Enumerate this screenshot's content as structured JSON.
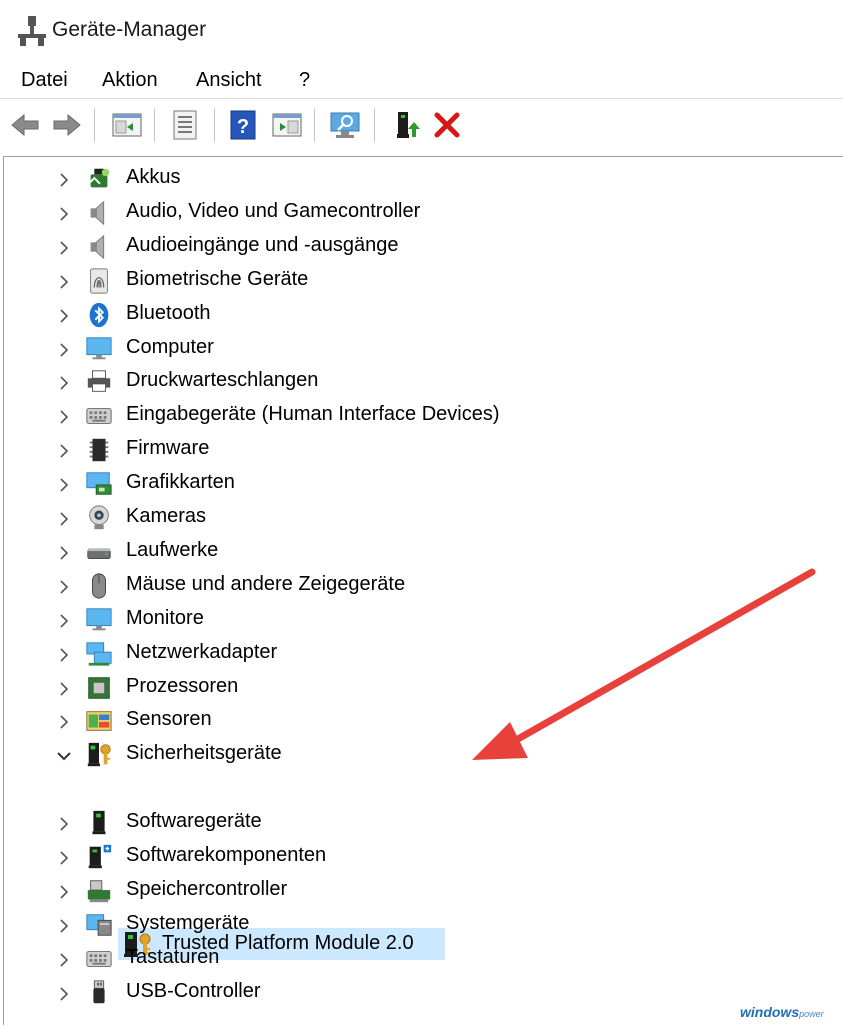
{
  "window": {
    "title": "Geräte-Manager"
  },
  "menu": [
    "Datei",
    "Aktion",
    "Ansicht",
    "?"
  ],
  "toolbar": {
    "buttons": [
      "back-icon",
      "forward-icon",
      "properties-pane-icon",
      "device-list-icon",
      "help-icon",
      "action-pane-icon",
      "scan-hardware-icon",
      "update-driver-icon",
      "uninstall-device-icon"
    ]
  },
  "tree": {
    "categories": [
      {
        "label": "Akkus",
        "icon": "battery-icon",
        "expanded": false
      },
      {
        "label": "Audio, Video und Gamecontroller",
        "icon": "speaker-icon",
        "expanded": false
      },
      {
        "label": "Audioeingänge und -ausgänge",
        "icon": "speaker-icon",
        "expanded": false
      },
      {
        "label": "Biometrische Geräte",
        "icon": "fingerprint-icon",
        "expanded": false
      },
      {
        "label": "Bluetooth",
        "icon": "bluetooth-icon",
        "expanded": false
      },
      {
        "label": "Computer",
        "icon": "monitor-icon",
        "expanded": false
      },
      {
        "label": "Druckwarteschlangen",
        "icon": "printer-icon",
        "expanded": false
      },
      {
        "label": "Eingabegeräte (Human Interface Devices)",
        "icon": "keyboard-icon",
        "expanded": false
      },
      {
        "label": "Firmware",
        "icon": "chip-icon",
        "expanded": false
      },
      {
        "label": "Grafikkarten",
        "icon": "display-adapter-icon",
        "expanded": false
      },
      {
        "label": "Kameras",
        "icon": "camera-icon",
        "expanded": false
      },
      {
        "label": "Laufwerke",
        "icon": "drive-icon",
        "expanded": false
      },
      {
        "label": "Mäuse und andere Zeigegeräte",
        "icon": "mouse-icon",
        "expanded": false
      },
      {
        "label": "Monitore",
        "icon": "monitor-icon",
        "expanded": false
      },
      {
        "label": "Netzwerkadapter",
        "icon": "network-icon",
        "expanded": false
      },
      {
        "label": "Prozessoren",
        "icon": "processor-icon",
        "expanded": false
      },
      {
        "label": "Sensoren",
        "icon": "sensor-icon",
        "expanded": false
      },
      {
        "label": "Sicherheitsgeräte",
        "icon": "security-key-icon",
        "expanded": true
      },
      {
        "label": "Softwaregeräte",
        "icon": "software-device-icon",
        "expanded": false
      },
      {
        "label": "Softwarekomponenten",
        "icon": "software-component-icon",
        "expanded": false
      },
      {
        "label": "Speichercontroller",
        "icon": "storage-controller-icon",
        "expanded": false
      },
      {
        "label": "Systemgeräte",
        "icon": "system-icon",
        "expanded": false
      },
      {
        "label": "Tastaturen",
        "icon": "keyboard-icon",
        "expanded": false
      },
      {
        "label": "USB-Controller",
        "icon": "usb-icon",
        "expanded": false
      }
    ],
    "selected_child": {
      "label": "Trusted Platform Module 2.0",
      "icon": "security-key-icon",
      "parent": "Sicherheitsgeräte"
    }
  },
  "annotation": {
    "type": "red-arrow",
    "points_to": "Trusted Platform Module 2.0"
  },
  "watermark": {
    "brand": "windows",
    "suffix": "power"
  },
  "colors": {
    "selection": "#cce8ff",
    "arrow": "#e8413c",
    "accent": "#1a7bd6"
  }
}
